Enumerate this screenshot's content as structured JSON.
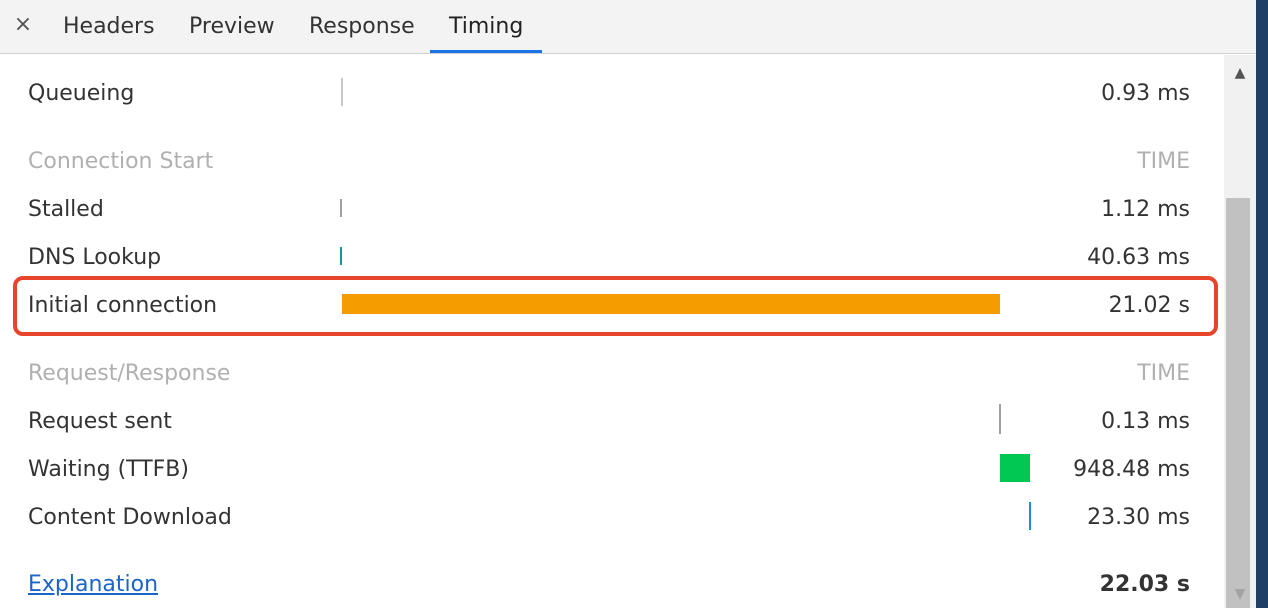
{
  "tabs": {
    "close_icon": "×",
    "items": [
      {
        "label": "Headers"
      },
      {
        "label": "Preview"
      },
      {
        "label": "Response"
      },
      {
        "label": "Timing"
      }
    ],
    "active": "Timing"
  },
  "sections": {
    "queueing": {
      "label": "Queueing",
      "time": "0.93 ms"
    },
    "connection_start": {
      "header_label": "Connection Start",
      "header_time": "TIME",
      "rows": [
        {
          "label": "Stalled",
          "time": "1.12 ms",
          "color": "#a0a0a0"
        },
        {
          "label": "DNS Lookup",
          "time": "40.63 ms",
          "color": "#0c9b9b"
        },
        {
          "label": "Initial connection",
          "time": "21.02 s",
          "color": "#f59c00"
        }
      ]
    },
    "request_response": {
      "header_label": "Request/Response",
      "header_time": "TIME",
      "rows": [
        {
          "label": "Request sent",
          "time": "0.13 ms",
          "color": "#a0a0a0"
        },
        {
          "label": "Waiting (TTFB)",
          "time": "948.48 ms",
          "color": "#00c853"
        },
        {
          "label": "Content Download",
          "time": "23.30 ms",
          "color": "#1a8fd8"
        }
      ]
    }
  },
  "footer": {
    "explanation_link": "Explanation",
    "total_time": "22.03 s"
  },
  "highlight_color": "#e8442c",
  "icons": {
    "scroll_up": "▲",
    "scroll_down": "▼"
  }
}
